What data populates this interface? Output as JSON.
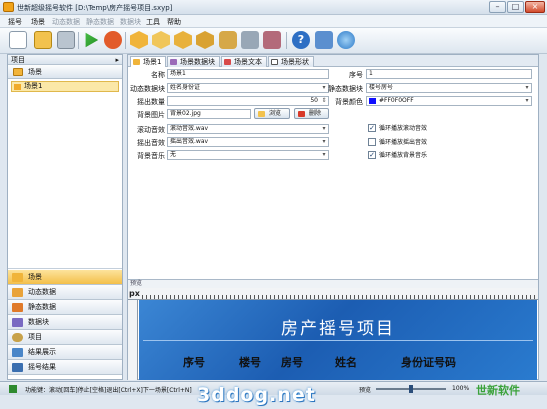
{
  "window": {
    "title": "世新超级摇号软件 [D:\\Temp\\房产摇号项目.sxyp]"
  },
  "menu": [
    "摇号",
    "场景",
    "动态数据",
    "静态数据",
    "数据块",
    "工具",
    "帮助"
  ],
  "toolbar_icons": [
    "new-icon",
    "open-icon",
    "save-icon",
    "play-icon",
    "stop-icon",
    "scene-icon",
    "dynamic-data-icon",
    "static-data-icon",
    "data-block-icon",
    "settings-icon",
    "tools-icon",
    "help-icon",
    "cart-icon",
    "web-icon"
  ],
  "left_pane": {
    "title": "项目",
    "group_label": "场景",
    "tree_item": "场景1",
    "nav": [
      "场景",
      "动态数据",
      "静态数据",
      "数据块",
      "项目",
      "结果展示",
      "摇号结果"
    ]
  },
  "tabs": [
    "场景1",
    "场景数据块",
    "场景文本",
    "场景形状"
  ],
  "form": {
    "name_label": "名称",
    "name_value": "场景1",
    "seq_label": "序号",
    "seq_value": "1",
    "dynblock_label": "动态数据块",
    "dynblock_value": "姓名身份证",
    "staticblock_label": "静态数据块",
    "staticblock_value": "楼号房号",
    "count_label": "摇出数量",
    "count_value": "50",
    "bgcolor_label": "背景颜色",
    "bgcolor_value": "#FF0F0OFF",
    "bgimg_label": "背景图片",
    "bgimg_value": "背景02.jpg",
    "browse_label": "浏览",
    "delete_label": "删除",
    "scroll_sound_label": "滚动音效",
    "scroll_sound_value": "滚动音效.wav",
    "out_sound_label": "摇出音效",
    "out_sound_value": "摇出音效.wav",
    "bgm_label": "背景音乐",
    "bgm_value": "无",
    "checks": [
      {
        "label": "循环播放滚动音效",
        "checked": true
      },
      {
        "label": "循环播放摇出音效",
        "checked": false
      },
      {
        "label": "循环播放背景音乐",
        "checked": true
      }
    ]
  },
  "preview": {
    "label": "预览",
    "ruler_unit": "px",
    "title": "房产摇号项目",
    "columns": [
      "序号",
      "楼号",
      "房号",
      "姓名",
      "身份证号码"
    ]
  },
  "status": {
    "text": "功能键：滚动[回车]停止[空格]退出[Ctrl+X]下一场景[Ctrl+N]",
    "preview_label": "预览",
    "zoom": "100%",
    "zoom_fraction": 0.5,
    "brand": "世新软件"
  },
  "watermark": "3ddog.net",
  "colors": {
    "accent": "#f3bf4a",
    "canvas": "#2a72c6",
    "bgcolor_swatch": "#0f0fff"
  }
}
